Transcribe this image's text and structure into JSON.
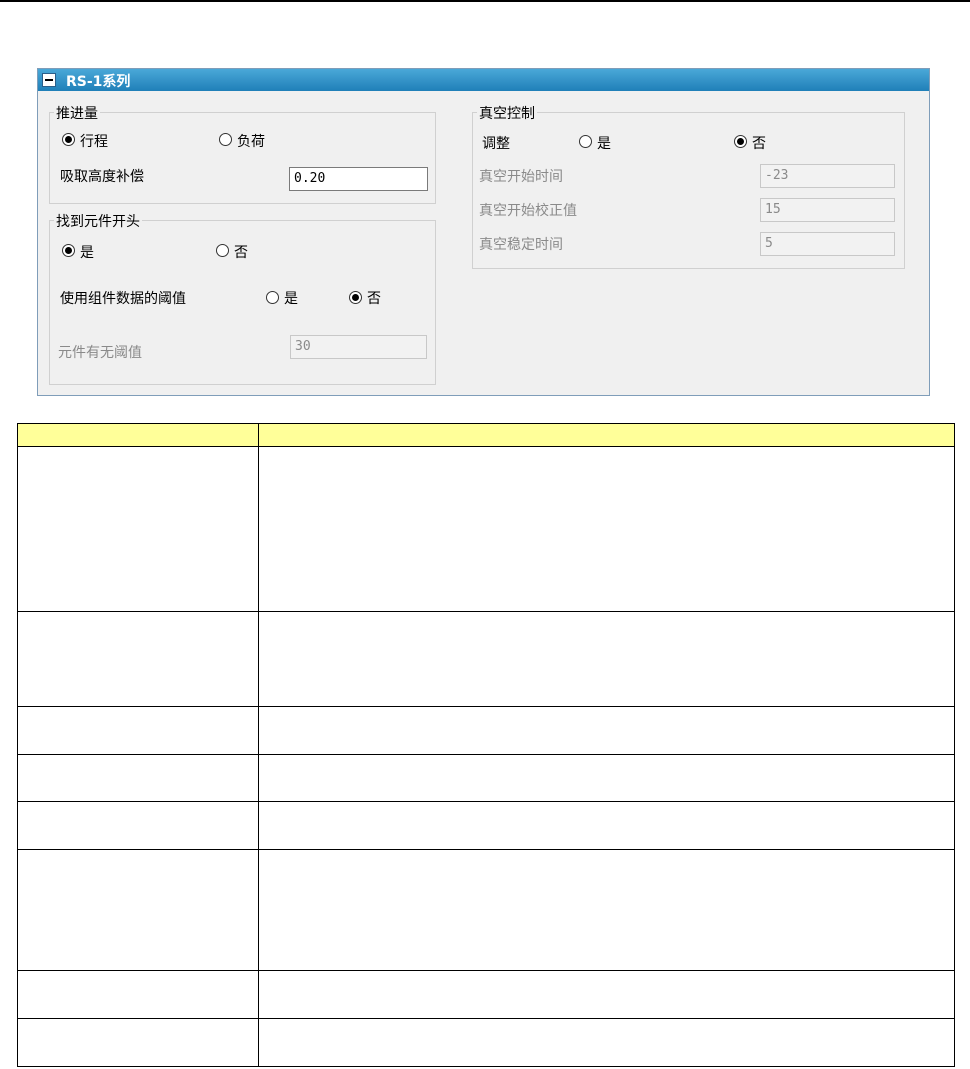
{
  "panel": {
    "title": "RS-1系列",
    "push_amount": {
      "legend": "推进量",
      "option_stroke": "行程",
      "option_load": "负荷",
      "selected": "行程",
      "suction_height_label": "吸取高度补偿",
      "suction_height_value": "0.20"
    },
    "find_component_head": {
      "legend": "找到元件开头",
      "option_yes": "是",
      "option_no": "否",
      "selected": "是",
      "use_component_threshold_label": "使用组件数据的阈值",
      "use_threshold_yes": "是",
      "use_threshold_no": "否",
      "use_threshold_selected": "否",
      "presence_threshold_label": "元件有无阈值",
      "presence_threshold_value": "30"
    },
    "vacuum_control": {
      "legend": "真空控制",
      "adjust_label": "调整",
      "adjust_yes": "是",
      "adjust_no": "否",
      "adjust_selected": "否",
      "start_time_label": "真空开始时间",
      "start_time_value": "-23",
      "start_correction_label": "真空开始校正值",
      "start_correction_value": "15",
      "stable_time_label": "真空稳定时间",
      "stable_time_value": "5"
    }
  },
  "table": {
    "header_fill": "#ffff99",
    "row_count": 8
  }
}
